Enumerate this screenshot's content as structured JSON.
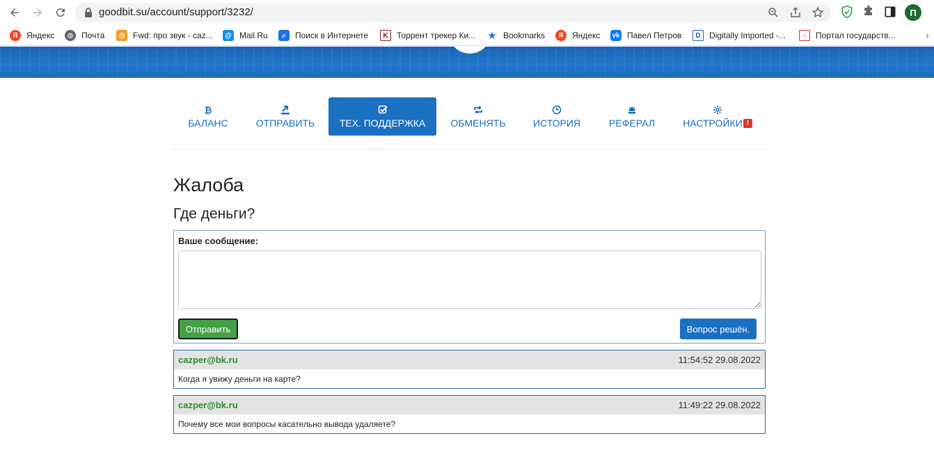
{
  "browser": {
    "url": "goodbit.su/account/support/3232/",
    "profile_initial": "П",
    "bookmarks": [
      {
        "label": "Яндекс",
        "icon": "yandex-icon",
        "color": "#fc3f1d"
      },
      {
        "label": "Почта",
        "icon": "globe-icon",
        "color": "#5f6368"
      },
      {
        "label": "Fwd: про звук - caz...",
        "icon": "mail-at-icon",
        "color": "#f29d1c"
      },
      {
        "label": "Mail.Ru",
        "icon": "mail-at-icon",
        "color": "#168de2"
      },
      {
        "label": "Поиск в Интернете",
        "icon": "search-icon",
        "color": "#1a73e8"
      },
      {
        "label": "Торрент трекер Ки...",
        "icon": "kinozal-icon",
        "color": "#8b1a1a"
      },
      {
        "label": "Bookmarks",
        "icon": "star-icon",
        "color": "#1a73e8"
      },
      {
        "label": "Яндекс",
        "icon": "yandex-icon",
        "color": "#fc3f1d"
      },
      {
        "label": "Павел Петров",
        "icon": "vk-icon",
        "color": "#0077ff"
      },
      {
        "label": "Digitally Imported -...",
        "icon": "di-icon",
        "color": "#1a5fb4"
      },
      {
        "label": "Портал государств...",
        "icon": "gosuslugi-icon",
        "color": "#d32f2f"
      }
    ]
  },
  "nav": {
    "tabs": [
      {
        "label": "БАЛАНС",
        "icon": "bitcoin-icon",
        "active": false,
        "alert": ""
      },
      {
        "label": "ОТПРАВИТЬ",
        "icon": "send-icon",
        "active": false,
        "alert": ""
      },
      {
        "label": "ТЕХ. ПОДДЕРЖКА",
        "icon": "check-square-icon",
        "active": true,
        "alert": ""
      },
      {
        "label": "ОБМЕНЯТЬ",
        "icon": "exchange-icon",
        "active": false,
        "alert": ""
      },
      {
        "label": "ИСТОРИЯ",
        "icon": "clock-icon",
        "active": false,
        "alert": ""
      },
      {
        "label": "РЕФЕРАЛ",
        "icon": "chess-king-icon",
        "active": false,
        "alert": ""
      },
      {
        "label": "НАСТРОЙКИ",
        "icon": "gear-icon",
        "active": false,
        "alert": "!"
      }
    ]
  },
  "page": {
    "title": "Жалоба",
    "subject": "Где деньги?"
  },
  "form": {
    "label": "Ваше сообщение:",
    "message_value": "",
    "send_label": "Отправить",
    "solved_label": "Вопрос решён."
  },
  "messages": [
    {
      "author": "cazper@bk.ru",
      "time": "11:54:52 29.08.2022",
      "text": "Когда я увижу деньги на карте?"
    },
    {
      "author": "cazper@bk.ru",
      "time": "11:49:22 29.08.2022",
      "text": "Почему все мои вопросы касательно вывода удаляете?"
    }
  ],
  "colors": {
    "accent": "#1a70c1",
    "send_button": "#43a047",
    "author": "#2e8b2e",
    "alert": "#d9392b"
  }
}
